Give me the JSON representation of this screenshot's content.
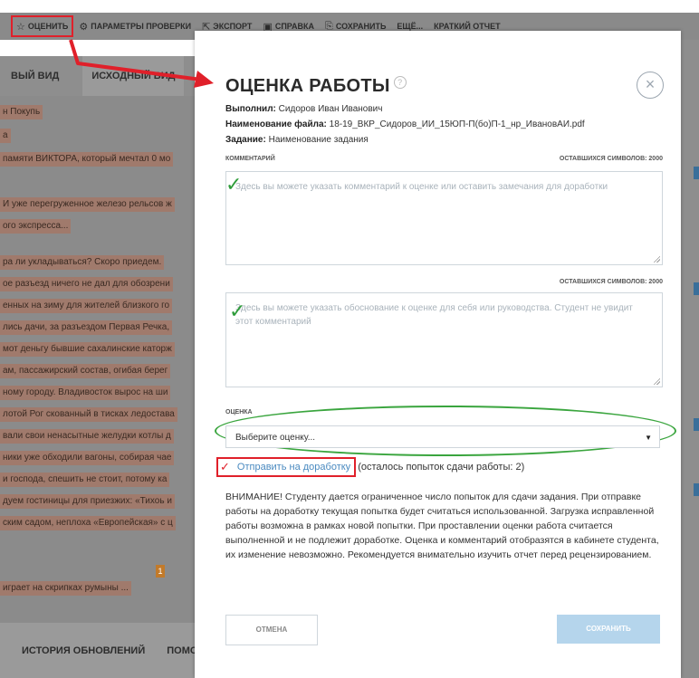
{
  "toolbar": {
    "items": [
      {
        "label": "Оценить",
        "icon": "star-icon"
      },
      {
        "label": "Параметры проверки",
        "icon": "gear-icon"
      },
      {
        "label": "Экспорт",
        "icon": "export-icon"
      },
      {
        "label": "Справка",
        "icon": "help-icon"
      },
      {
        "label": "Сохранить",
        "icon": "save-icon"
      },
      {
        "label": "Ещё...",
        "icon": ""
      },
      {
        "label": "Краткий отчет",
        "icon": ""
      }
    ]
  },
  "background": {
    "tabs": [
      "вый вид",
      "исходный вид"
    ],
    "doc_lines": [
      "н Покупь",
      "а",
      "памяти ВИКТОРА, который мечтал 0 мо",
      "И уже перегруженное железо рельсов ж",
      "ого экспресса...",
      "ра ли укладываться? Скоро приедем.",
      "ое разъезд ничего не дал для обозрени",
      "енных на зиму для жителей близкого го",
      "лись дачи, за разъездом Первая Речка,",
      "мот деньгу бывшие сахалинские каторж",
      "ам, пассажирский состав, огибая берег",
      "ному городу. Владивосток вырос на ши",
      "лотой Рог скованный в тисках ледостава",
      "вали свои ненасытные желудки котлы д",
      "ники уже обходили вагоны, собирая чае",
      "и господа, спешить не стоит, потому ка",
      "дуем гостиницы для приезжих: «Тихоь и",
      "ским садом, неплоха «Европейская» с ц",
      "играет на скрипках румыны ..."
    ],
    "bottom_tabs": [
      "История обновлений",
      "Помо"
    ]
  },
  "modal": {
    "title": "ОЦЕНКА РАБОТЫ",
    "help_symbol": "?",
    "close_symbol": "×",
    "performer_label": "Выполнил:",
    "performer_value": "Сидоров Иван Иванович",
    "filename_label": "Наименование файла:",
    "filename_value": "18-19_ВКР_Сидоров_ИИ_15ЮП-П(бо)П-1_нр_ИвановАИ.pdf",
    "task_label": "Задание:",
    "task_value": "Наименование задания",
    "comment_label": "Комментарий",
    "chars_left_1": "Оставшихся символов: 2000",
    "comment_placeholder": "Здесь вы можете указать комментарий к оценке или оставить замечания для доработки",
    "chars_left_2": "Оставшихся символов: 2000",
    "justification_placeholder": "Здесь вы можете указать обоснование к оценке для себя или руководства. Студент не увидит этот комментарий",
    "grade_label": "Оценка",
    "grade_placeholder": "Выберите оценку...",
    "send_for_revision": "Отправить на доработку",
    "attempts_left": "(осталось попыток сдачи работы: 2)",
    "warning": "ВНИМАНИЕ! Студенту дается ограниченное число попыток для сдачи задания. При отправке работы на доработку текущая попытка будет считаться использованной. Загрузка исправленной работы возможна в рамках новой попытки. При проставлении оценки работа считается выполненной и не подлежит доработке. Оценка и комментарий отобразятся в кабинете студента, их изменение невозможно. Рекомендуется внимательно изучить отчет перед рецензированием.",
    "cancel": "Отмена",
    "save": "Сохранить"
  },
  "colors": {
    "annotation_red": "#e0202a",
    "annotation_green": "#3aa53e",
    "save_button": "#b5d5ec",
    "link_blue": "#4a8ac0"
  }
}
